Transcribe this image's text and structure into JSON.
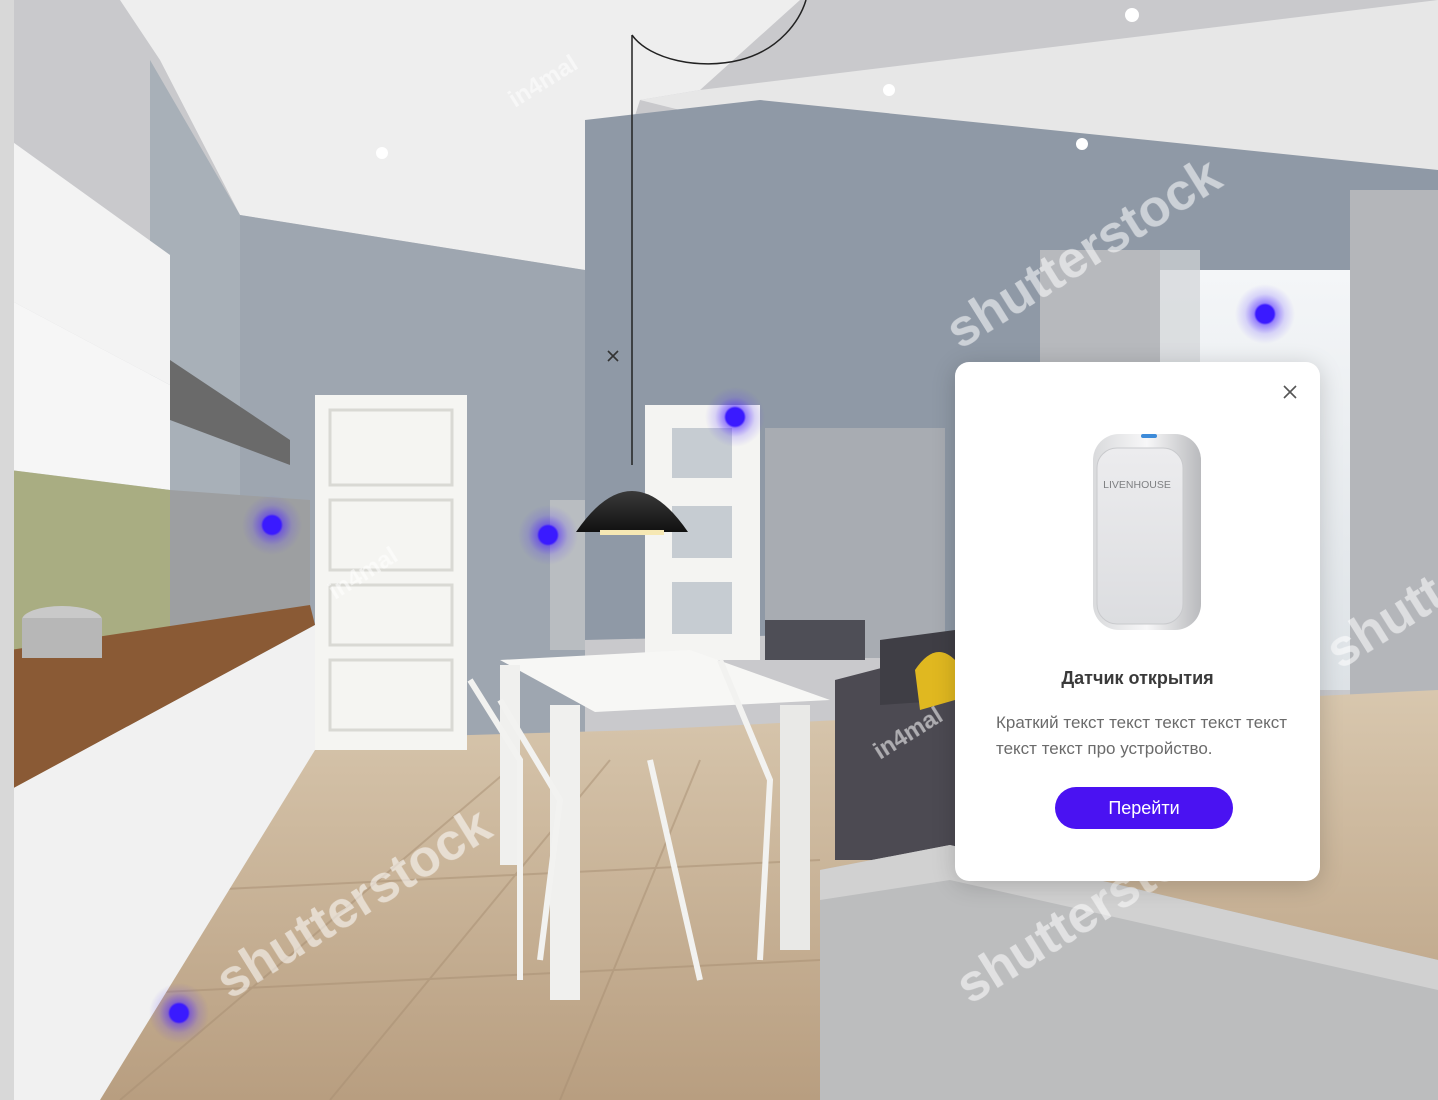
{
  "popup": {
    "title": "Датчик открытия",
    "description": "Краткий текст текст текст текст текст текст текст про устройство.",
    "button_label": "Перейти",
    "device_brand": "LIVENHOUSE"
  },
  "watermarks": {
    "stock": "shutterstock",
    "author": "in4mal"
  },
  "colors": {
    "accent": "#4a12f2",
    "hotspot": "#3a1aff"
  },
  "icons": {
    "popup_close": "close-icon",
    "scene_close": "close-icon"
  }
}
